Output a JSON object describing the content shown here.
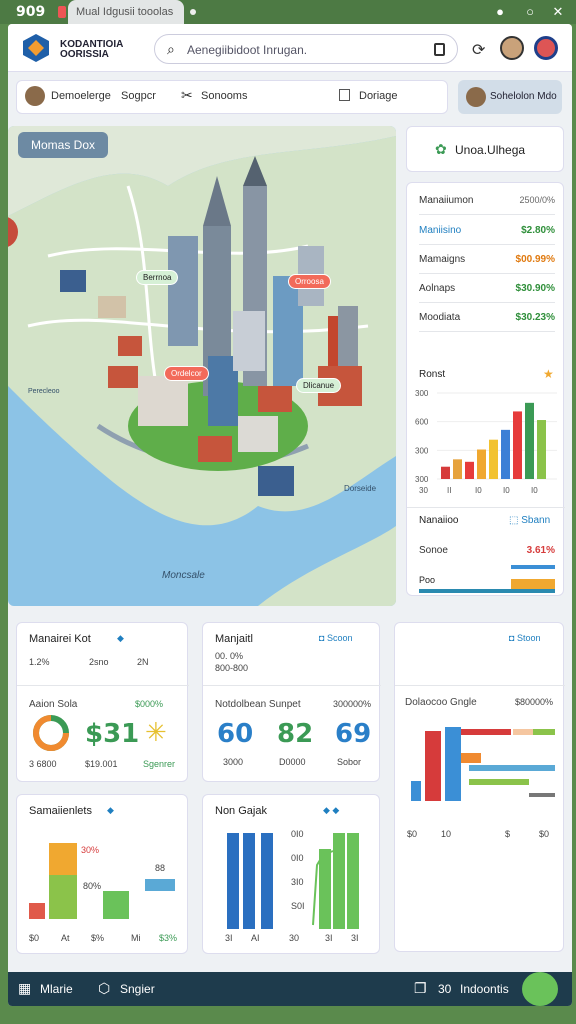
{
  "status": {
    "time": "909",
    "tab_label": "Mual Idgusii tooolas"
  },
  "header": {
    "logo_text_line1": "KODANTIOIA",
    "logo_text_line2": "OORISSIA",
    "search_placeholder": "Aenegiibidoot Inrugan.",
    "brand_color": "#1f5fa8"
  },
  "toolbar": {
    "item1": "Demoelerge",
    "item2": "Sogpcr",
    "item3": "Sonooms",
    "item4": "Doriage",
    "right_button": "Sohelolon Mdo"
  },
  "map": {
    "label": "Momas Dox",
    "pins": [
      "Berrnoa",
      "Orroosa",
      "Ordelcor",
      "Dlicanue"
    ],
    "annotations": [
      "Perecleoo",
      "Dorseide",
      "Moncsale"
    ]
  },
  "panel": {
    "title": "Unoa.Ulhega",
    "metrics_header": {
      "name": "Manaiiumon",
      "value": "2500/0%"
    },
    "metrics": [
      {
        "name": "Maniisino",
        "value": "$2.80%",
        "color": "#2f8f3a",
        "name_color": "#1f7fc0"
      },
      {
        "name": "Mamaigns",
        "value": "$00.99%",
        "color": "#e07a10",
        "name_color": "#333"
      },
      {
        "name": "Aolnaps",
        "value": "$30.90%",
        "color": "#2f8f3a",
        "name_color": "#333"
      },
      {
        "name": "Moodiata",
        "value": "$30.23%",
        "color": "#2f8f3a",
        "name_color": "#333"
      }
    ],
    "chart_title": "Ronst",
    "chart_yticks": [
      "300",
      "600",
      "300",
      "300"
    ],
    "chart_xticks": [
      "30",
      "II",
      "I0",
      "I0",
      "I0"
    ],
    "bars": [
      {
        "value": 10,
        "color": "#d63b3b"
      },
      {
        "value": 16,
        "color": "#e6a23c"
      },
      {
        "value": 14,
        "color": "#e63b3b"
      },
      {
        "value": 24,
        "color": "#f0a830"
      },
      {
        "value": 32,
        "color": "#f2c230"
      },
      {
        "value": 40,
        "color": "#3b7fd6"
      },
      {
        "value": 55,
        "color": "#e63b3b"
      },
      {
        "value": 62,
        "color": "#3b9a55"
      },
      {
        "value": 48,
        "color": "#8bc34a"
      }
    ],
    "progress_title": "Nanaiioo",
    "progress_link": "Sbann",
    "progress_row1_label": "Sonoe",
    "progress_row1_value": "3.61%",
    "progress_row2_label": "Poo"
  },
  "cards": {
    "c1": {
      "title": "Manairei Kot",
      "vals": [
        "1.2%",
        "2sno",
        "2N"
      ],
      "sub": "Aaion Sola",
      "sub_val": "$000%",
      "num1": "$31",
      "num1_note": "$19.001",
      "left_note": "3 6800",
      "right_note": "Sgenrer"
    },
    "c2": {
      "title": "Manjaitl",
      "link": "Scoon",
      "sub1": "00. 0%",
      "sub2": "800-800",
      "sub": "Notdolbean  Sunpet",
      "sub_val": "300000%",
      "n1": "60",
      "n2": "82",
      "n3": "69",
      "n1_note": "3000",
      "n2_note": "D0000",
      "n3_note": "Sobor"
    },
    "c3": {
      "link": "Stoon",
      "title": "Dolaocoo Gngle",
      "val": "$80000%",
      "axis": [
        "$0",
        "10",
        "$",
        "$0"
      ]
    },
    "c4": {
      "title": "Samaiienlets",
      "tags": [
        "30%",
        "80%",
        "88"
      ],
      "ticks": [
        "$0",
        "At",
        "$%",
        "Mi",
        "$3%"
      ]
    },
    "c5": {
      "title": "Non Gajak",
      "ticks": [
        "3I",
        "AI",
        "30",
        "3I",
        "3I"
      ],
      "yticks": [
        "0I0",
        "0I0",
        "3I0",
        "S0I"
      ]
    }
  },
  "footer": {
    "left1": "Mlarie",
    "left2": "Sngier",
    "right": "Indoontis",
    "right_num": "30"
  }
}
